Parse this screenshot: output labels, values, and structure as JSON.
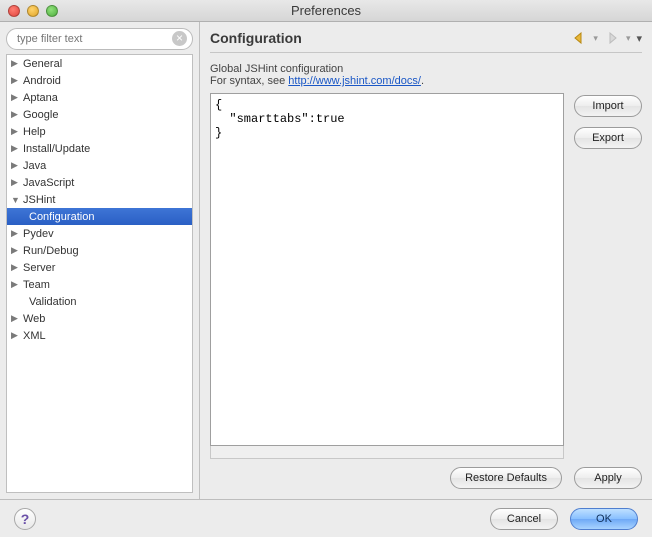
{
  "window": {
    "title": "Preferences"
  },
  "filter": {
    "placeholder": "type filter text"
  },
  "tree": [
    {
      "label": "General",
      "expanded": false
    },
    {
      "label": "Android",
      "expanded": false
    },
    {
      "label": "Aptana",
      "expanded": false
    },
    {
      "label": "Google",
      "expanded": false
    },
    {
      "label": "Help",
      "expanded": false
    },
    {
      "label": "Install/Update",
      "expanded": false
    },
    {
      "label": "Java",
      "expanded": false
    },
    {
      "label": "JavaScript",
      "expanded": false
    },
    {
      "label": "JSHint",
      "expanded": true,
      "children": [
        {
          "label": "Configuration",
          "selected": true
        }
      ]
    },
    {
      "label": "Pydev",
      "expanded": false
    },
    {
      "label": "Run/Debug",
      "expanded": false
    },
    {
      "label": "Server",
      "expanded": false
    },
    {
      "label": "Team",
      "expanded": false,
      "children_flat": [
        {
          "label": "Validation"
        }
      ]
    },
    {
      "label": "Web",
      "expanded": false
    },
    {
      "label": "XML",
      "expanded": false
    }
  ],
  "page": {
    "heading": "Configuration",
    "description_prefix": "Global JSHint configuration",
    "syntax_prefix": "For syntax, see ",
    "syntax_link_text": "http://www.jshint.com/docs/",
    "syntax_suffix": ".",
    "editor_value": "{\n  \"smarttabs\":true\n}"
  },
  "buttons": {
    "import": "Import",
    "export": "Export",
    "restore": "Restore Defaults",
    "apply": "Apply",
    "cancel": "Cancel",
    "ok": "OK"
  }
}
